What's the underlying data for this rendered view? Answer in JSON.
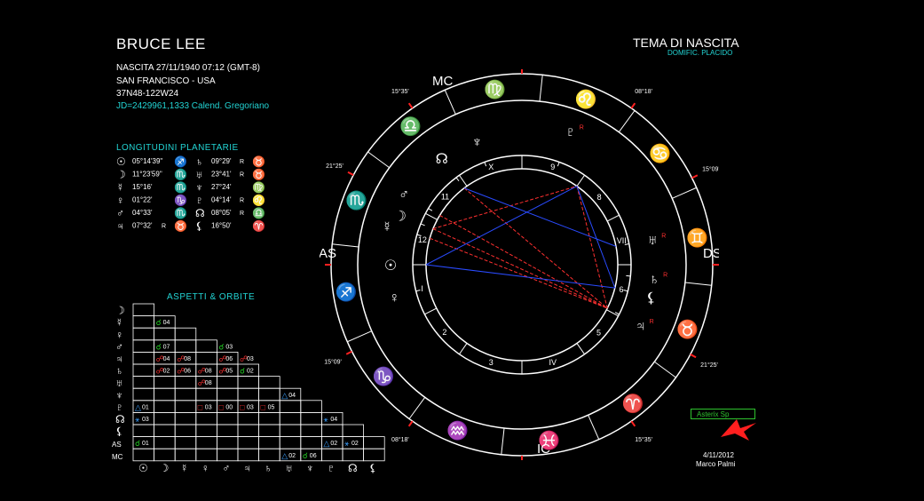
{
  "subject": {
    "name": "BRUCE LEE",
    "birth": "NASCITA 27/11/1940 07:12 (GMT-8)",
    "place": "SAN FRANCISCO - USA",
    "coords": "37N48-122W24",
    "jd": "JD=2429961,1333  Calend. Gregoriano"
  },
  "chart_title": "TEMA DI NASCITA",
  "domification": "DOMIFIC. PLACIDO",
  "planet_section": {
    "title": "LONGITUDINI PLANETARIE",
    "rows": [
      {
        "glyph": "☉",
        "deg": "05°14'39\"",
        "sign": "♐",
        "sign_color": "#ff3030",
        "retro": "",
        "glyph2": "♄",
        "deg2": "09°29'",
        "retro2": "R",
        "sign2": "♉",
        "sign2_color": "#22cc22"
      },
      {
        "glyph": "☽",
        "deg": "11°23'59\"",
        "sign": "♏",
        "sign_color": "#1fd4d4",
        "retro": "",
        "glyph2": "♅",
        "deg2": "23°41'",
        "retro2": "R",
        "sign2": "♉",
        "sign2_color": "#22cc22"
      },
      {
        "glyph": "☿",
        "deg": "15°16'",
        "sign": "♏",
        "sign_color": "#1fd4d4",
        "retro": "",
        "glyph2": "♆",
        "deg2": "27°24'",
        "retro2": "",
        "sign2": "♍",
        "sign2_color": "#22cc22"
      },
      {
        "glyph": "♀",
        "deg": "01°22'",
        "sign": "♑",
        "sign_color": "#22cc22",
        "retro": "",
        "glyph2": "♇",
        "deg2": "04°14'",
        "retro2": "R",
        "sign2": "♌",
        "sign2_color": "#ff3030"
      },
      {
        "glyph": "♂",
        "deg": "04°33'",
        "sign": "♏",
        "sign_color": "#1fd4d4",
        "retro": "",
        "glyph2": "☊",
        "deg2": "08°05'",
        "retro2": "R",
        "sign2": "♎",
        "sign2_color": "#ff44ff"
      },
      {
        "glyph": "♃",
        "deg": "07°32'",
        "sign": "♉",
        "sign_color": "#22cc22",
        "retro": "R",
        "glyph2": "⚸",
        "deg2": "16°50'",
        "retro2": "",
        "sign2": "♈",
        "sign2_color": "#ff3030"
      }
    ]
  },
  "aspects": {
    "title": "ASPETTI & ORBITE",
    "row_labels": [
      "☽",
      "☿",
      "♀",
      "♂",
      "♃",
      "♄",
      "♅",
      "♆",
      "♇",
      "☊",
      "⚸",
      "AS",
      "MC"
    ],
    "col_labels": [
      "☉",
      "☽",
      "☿",
      "♀",
      "♂",
      "♃",
      "♄",
      "♅",
      "♆",
      "♇",
      "☊",
      "⚸"
    ],
    "cells": [
      {
        "r": 1,
        "c": 1,
        "sym": "☌",
        "color": "#22cc22",
        "orb": "04"
      },
      {
        "r": 3,
        "c": 1,
        "sym": "☌",
        "color": "#22cc22",
        "orb": "07"
      },
      {
        "r": 3,
        "c": 4,
        "sym": "☌",
        "color": "#22cc22",
        "orb": "03"
      },
      {
        "r": 4,
        "c": 1,
        "sym": "☍",
        "color": "#ff3030",
        "orb": "04"
      },
      {
        "r": 4,
        "c": 2,
        "sym": "☍",
        "color": "#ff3030",
        "orb": "08"
      },
      {
        "r": 4,
        "c": 4,
        "sym": "☍",
        "color": "#ff3030",
        "orb": "06"
      },
      {
        "r": 4,
        "c": 5,
        "sym": "☍",
        "color": "#ff3030",
        "orb": "03"
      },
      {
        "r": 5,
        "c": 1,
        "sym": "☍",
        "color": "#ff3030",
        "orb": "02"
      },
      {
        "r": 5,
        "c": 2,
        "sym": "☍",
        "color": "#ff3030",
        "orb": "06"
      },
      {
        "r": 5,
        "c": 3,
        "sym": "☍",
        "color": "#ff3030",
        "orb": "08"
      },
      {
        "r": 5,
        "c": 4,
        "sym": "☍",
        "color": "#ff3030",
        "orb": "05"
      },
      {
        "r": 5,
        "c": 5,
        "sym": "☌",
        "color": "#22cc22",
        "orb": "02"
      },
      {
        "r": 6,
        "c": 3,
        "sym": "☍",
        "color": "#ff3030",
        "orb": "08"
      },
      {
        "r": 7,
        "c": 7,
        "sym": "△",
        "color": "#3ba0ff",
        "orb": "04"
      },
      {
        "r": 8,
        "c": 0,
        "sym": "△",
        "color": "#3ba0ff",
        "orb": "01"
      },
      {
        "r": 8,
        "c": 3,
        "sym": "□",
        "color": "#ff3030",
        "orb": "03"
      },
      {
        "r": 8,
        "c": 4,
        "sym": "□",
        "color": "#ff3030",
        "orb": "00"
      },
      {
        "r": 8,
        "c": 5,
        "sym": "□",
        "color": "#ff3030",
        "orb": "03"
      },
      {
        "r": 8,
        "c": 6,
        "sym": "□",
        "color": "#ff3030",
        "orb": "05"
      },
      {
        "r": 9,
        "c": 0,
        "sym": "⚹",
        "color": "#3ba0ff",
        "orb": "03"
      },
      {
        "r": 9,
        "c": 9,
        "sym": "⚹",
        "color": "#3ba0ff",
        "orb": "04"
      },
      {
        "r": 11,
        "c": 0,
        "sym": "☌",
        "color": "#22cc22",
        "orb": "01"
      },
      {
        "r": 11,
        "c": 9,
        "sym": "△",
        "color": "#3ba0ff",
        "orb": "02"
      },
      {
        "r": 11,
        "c": 10,
        "sym": "⚹",
        "color": "#3ba0ff",
        "orb": "02"
      },
      {
        "r": 12,
        "c": 7,
        "sym": "△",
        "color": "#3ba0ff",
        "orb": "02"
      },
      {
        "r": 12,
        "c": 8,
        "sym": "☌",
        "color": "#22cc22",
        "orb": "06"
      }
    ]
  },
  "wheel": {
    "angles": {
      "mc": "MC",
      "as": "AS",
      "ds": "DS",
      "ic": "IC"
    },
    "house_numbers": [
      "I",
      "2",
      "3",
      "IV",
      "5",
      "6",
      "VII",
      "8",
      "9",
      "X",
      "11",
      "12"
    ],
    "cusp_degrees": [
      "21°16'",
      "15°09'",
      "08°18'",
      "06°12'",
      "15°35'",
      "21°25'",
      "21°16'",
      "15°09'",
      "08°18'",
      "06°12'",
      "15°35'",
      "21°25'"
    ],
    "zodiac": [
      {
        "glyph": "♐",
        "color": "#ff3030"
      },
      {
        "glyph": "♏",
        "color": "#1fd4d4"
      },
      {
        "glyph": "♎",
        "color": "#ff44ff"
      },
      {
        "glyph": "♍",
        "color": "#22cc22"
      },
      {
        "glyph": "♌",
        "color": "#ff3030"
      },
      {
        "glyph": "♋",
        "color": "#1fd4d4"
      },
      {
        "glyph": "♊",
        "color": "#ff44ff"
      },
      {
        "glyph": "♉",
        "color": "#22cc22"
      },
      {
        "glyph": "♈",
        "color": "#ff3030"
      },
      {
        "glyph": "♓",
        "color": "#1fd4d4"
      },
      {
        "glyph": "♒",
        "color": "#ff44ff"
      },
      {
        "glyph": "♑",
        "color": "#22cc22"
      }
    ],
    "planets": [
      {
        "glyph": "☉",
        "retro": ""
      },
      {
        "glyph": "☽",
        "retro": ""
      },
      {
        "glyph": "☿",
        "retro": ""
      },
      {
        "glyph": "♂",
        "retro": ""
      },
      {
        "glyph": "☊",
        "retro": ""
      },
      {
        "glyph": "♆",
        "retro": ""
      },
      {
        "glyph": "♇",
        "retro": "R"
      },
      {
        "glyph": "⚸",
        "retro": ""
      },
      {
        "glyph": "♅",
        "retro": "R"
      },
      {
        "glyph": "♄",
        "retro": "R"
      },
      {
        "glyph": "♃",
        "retro": "R"
      },
      {
        "glyph": "♀",
        "retro": ""
      }
    ]
  },
  "footer": {
    "asterix_label": "Asterix Sp",
    "date": "4/11/2012",
    "author": "Marco Palmi"
  }
}
